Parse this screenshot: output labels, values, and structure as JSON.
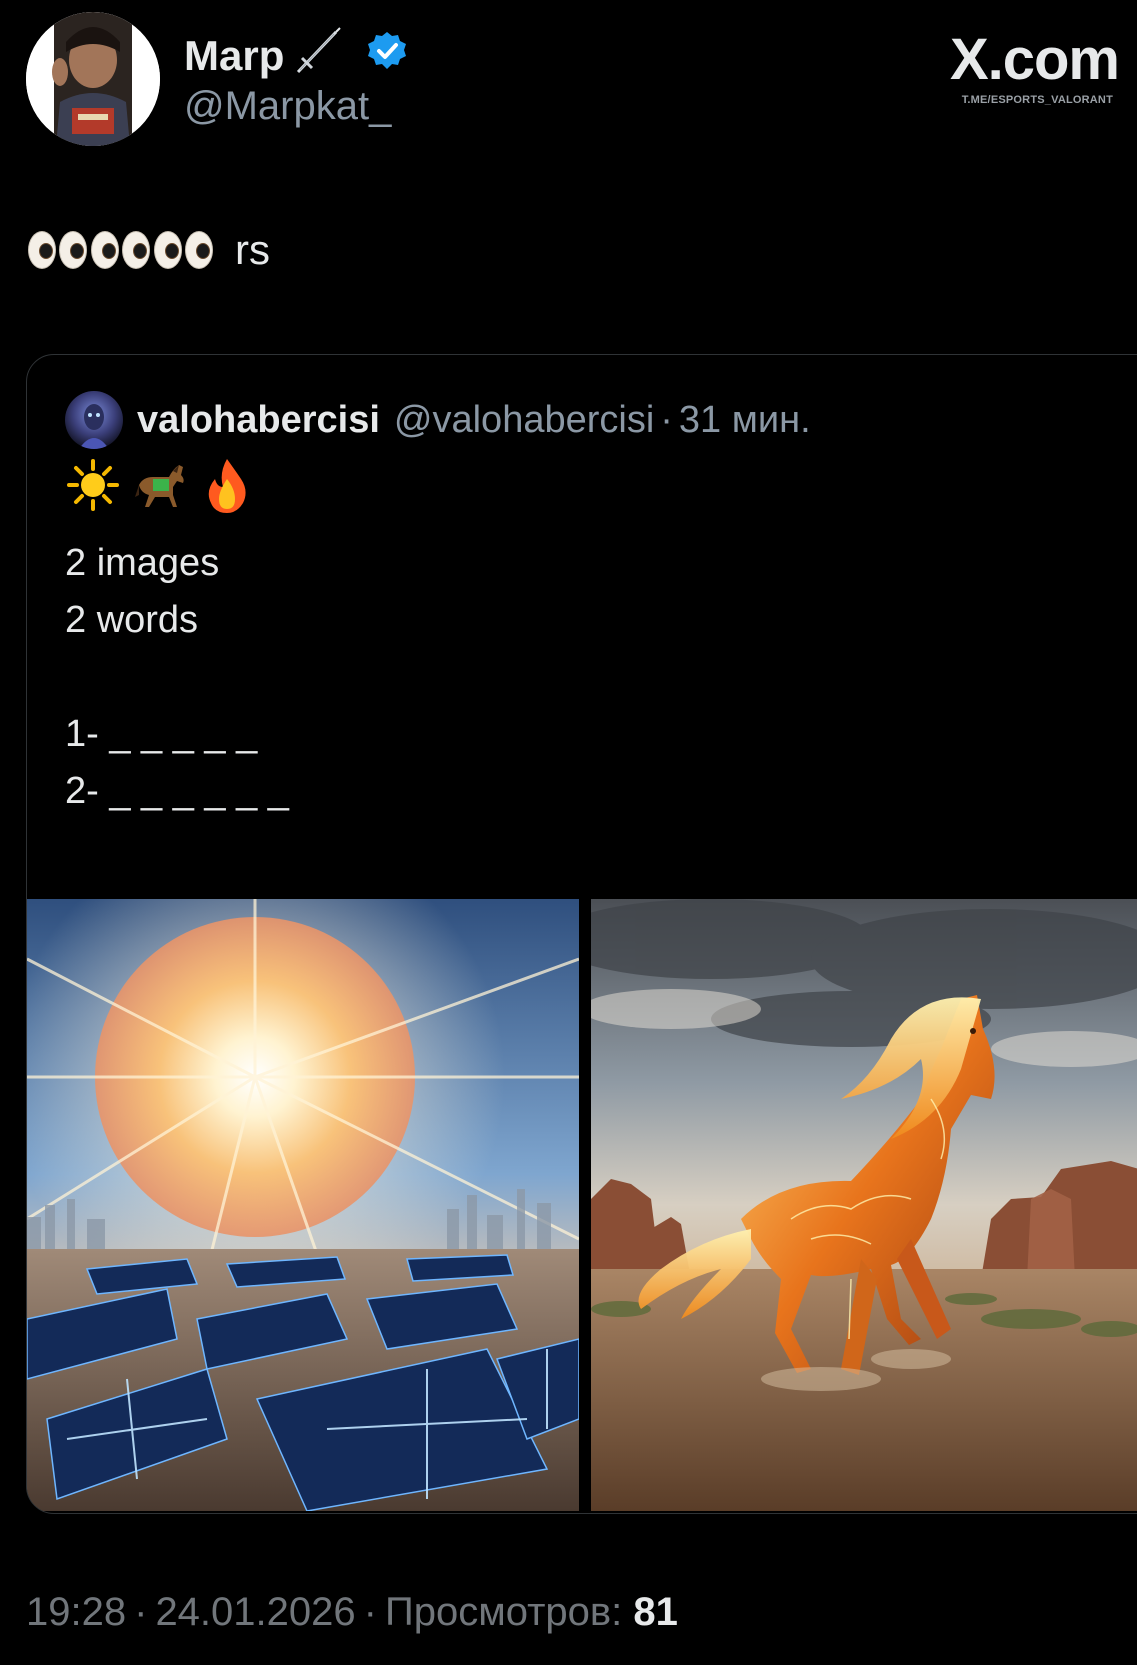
{
  "author": {
    "display_name": "Marp",
    "name_badge_icon": "sword-icon",
    "verified_icon": "verified-badge-icon",
    "handle": "@Marpkat_"
  },
  "brand": {
    "logo": "X.com",
    "watermark": "T.ME/ESPORTS_VALORANT"
  },
  "tweet": {
    "emoji": [
      "eyes-emoji",
      "eyes-emoji",
      "eyes-emoji"
    ],
    "text": "rs"
  },
  "quoted_tweet": {
    "display_name": "valohabercisi",
    "handle": "@valohabercisi",
    "separator": "·",
    "time": "31 мин.",
    "emoji": [
      "sun-emoji",
      "horse-emoji",
      "fire-emoji"
    ],
    "lines": [
      "2 images",
      "2 words",
      "",
      "1- _ _ _ _ _",
      "2- _ _ _ _ _ _"
    ],
    "images": [
      "sun-over-solar-panels-image",
      "fire-horse-in-desert-image"
    ]
  },
  "footer": {
    "time": "19:28",
    "separator": "·",
    "date": "24.01.2026",
    "views_label": "Просмотров:",
    "views_count": "81"
  },
  "colors": {
    "background": "#000000",
    "text_primary": "#e7e9ea",
    "text_secondary": "#8b98a5",
    "verified_blue": "#1d9bf0",
    "border": "#2f3336"
  }
}
